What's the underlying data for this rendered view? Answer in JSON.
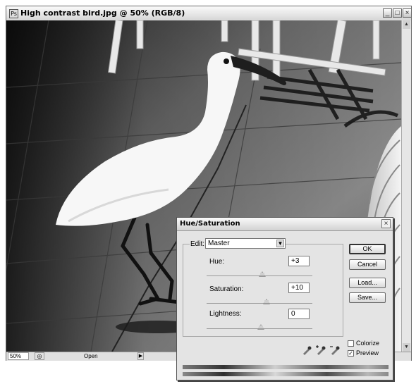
{
  "document": {
    "title": "High contrast bird.jpg @ 50% (RGB/8)",
    "window_buttons": {
      "minimize": "_",
      "maximize": "□",
      "close": "×"
    },
    "status": {
      "zoom": "50%",
      "open_label": "Open",
      "nav_icon": "◎",
      "arrow": "▶"
    }
  },
  "dialog": {
    "title": "Hue/Saturation",
    "edit_label": "Edit:",
    "edit_value": "Master",
    "hue": {
      "label": "Hue:",
      "value": "+3"
    },
    "saturation": {
      "label": "Saturation:",
      "value": "+10"
    },
    "lightness": {
      "label": "Lightness:",
      "value": "0"
    },
    "buttons": {
      "ok": "OK",
      "cancel": "Cancel",
      "load": "Load...",
      "save": "Save..."
    },
    "colorize": {
      "label": "Colorize",
      "checked": false
    },
    "preview": {
      "label": "Preview",
      "checked": true
    },
    "check_mark": "✓"
  }
}
